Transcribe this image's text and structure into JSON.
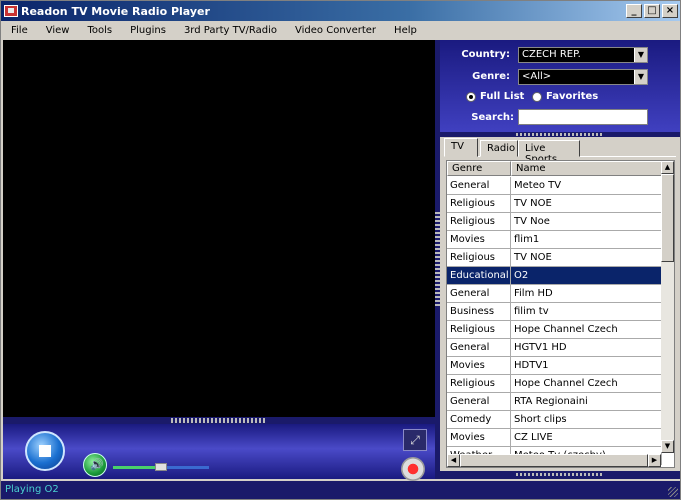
{
  "window": {
    "title": "Readon TV Movie Radio Player",
    "min": "_",
    "max": "□",
    "close": "×"
  },
  "menu": [
    "File",
    "View",
    "Tools",
    "Plugins",
    "3rd Party TV/Radio",
    "Video Converter",
    "Help"
  ],
  "filter": {
    "country_label": "Country:",
    "country_value": "CZECH REP.",
    "genre_label": "Genre:",
    "genre_value": "<All>",
    "full_list": "Full List",
    "favorites": "Favorites",
    "search_label": "Search:",
    "search_value": ""
  },
  "tabs": [
    "TV",
    "Radio",
    "Live Sports"
  ],
  "grid": {
    "headers": [
      "Genre",
      "Name"
    ],
    "rows": [
      [
        "General",
        "Meteo TV"
      ],
      [
        "Religious",
        "TV NOE"
      ],
      [
        "Religious",
        "TV Noe"
      ],
      [
        "Movies",
        "flim1"
      ],
      [
        "Religious",
        "TV NOE"
      ],
      [
        "Educational",
        "O2"
      ],
      [
        "General",
        "Film HD"
      ],
      [
        "Business",
        "filim tv"
      ],
      [
        "Religious",
        "Hope Channel Czech"
      ],
      [
        "General",
        "HGTV1 HD"
      ],
      [
        "Movies",
        "HDTV1"
      ],
      [
        "Religious",
        "Hope Channel Czech"
      ],
      [
        "General",
        "RTA Regionaini"
      ],
      [
        "Comedy",
        "Short clips"
      ],
      [
        "Movies",
        "CZ LIVE"
      ],
      [
        "Weather",
        "Meteo Tv (czechy)"
      ]
    ],
    "selected_index": 5
  },
  "status": "Playing O2",
  "volume": 0.5,
  "icons": {
    "stop": "stop-icon",
    "mute": "speaker-icon",
    "fullscreen": "fullscreen-icon",
    "record": "record-icon"
  }
}
